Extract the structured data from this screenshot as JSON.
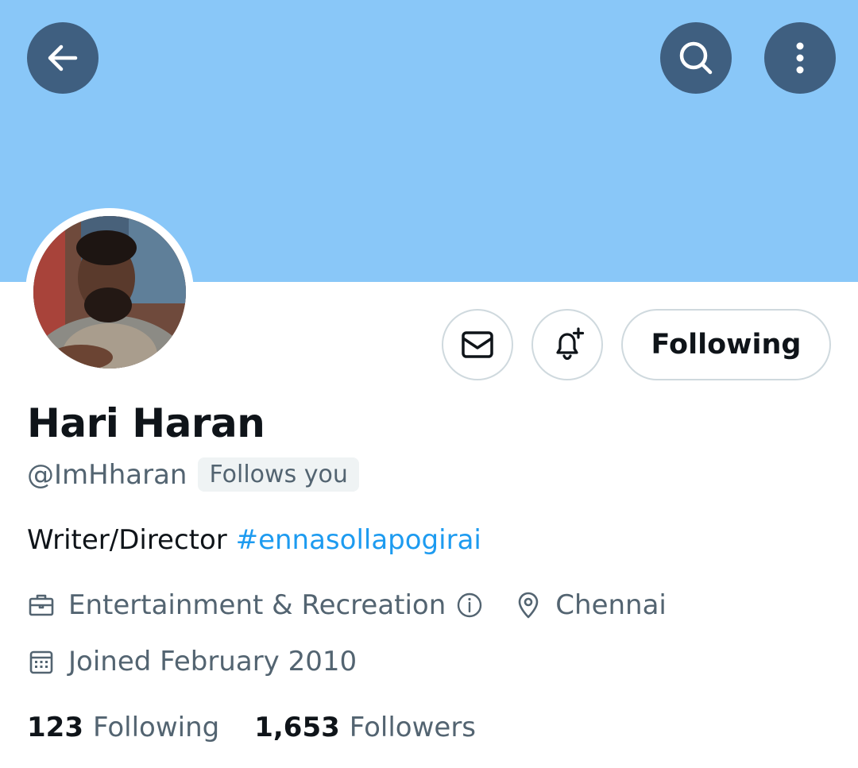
{
  "profile": {
    "display_name": "Hari Haran",
    "handle": "@ImHharan",
    "follows_you_badge": "Follows you",
    "bio_text": "Writer/Director ",
    "bio_hashtag": "#ennasollapogirai",
    "category": "Entertainment & Recreation",
    "location": "Chennai",
    "joined": "Joined February 2010"
  },
  "actions": {
    "follow_button_label": "Following"
  },
  "stats": {
    "following_count": "123",
    "following_label": "Following",
    "followers_count": "1,653",
    "followers_label": "Followers"
  },
  "icons": {
    "back": "arrow-left-icon",
    "search": "search-icon",
    "more": "more-vertical-icon",
    "message": "envelope-icon",
    "notify": "bell-plus-icon",
    "category": "briefcase-icon",
    "info": "info-icon",
    "location": "map-pin-icon",
    "joined": "calendar-icon"
  },
  "colors": {
    "banner": "#89c7f8",
    "nav_button": "#3f5f80",
    "link": "#1d9bf0",
    "secondary_text": "#536471",
    "primary_text": "#0f1419",
    "border": "#cfd9de"
  }
}
